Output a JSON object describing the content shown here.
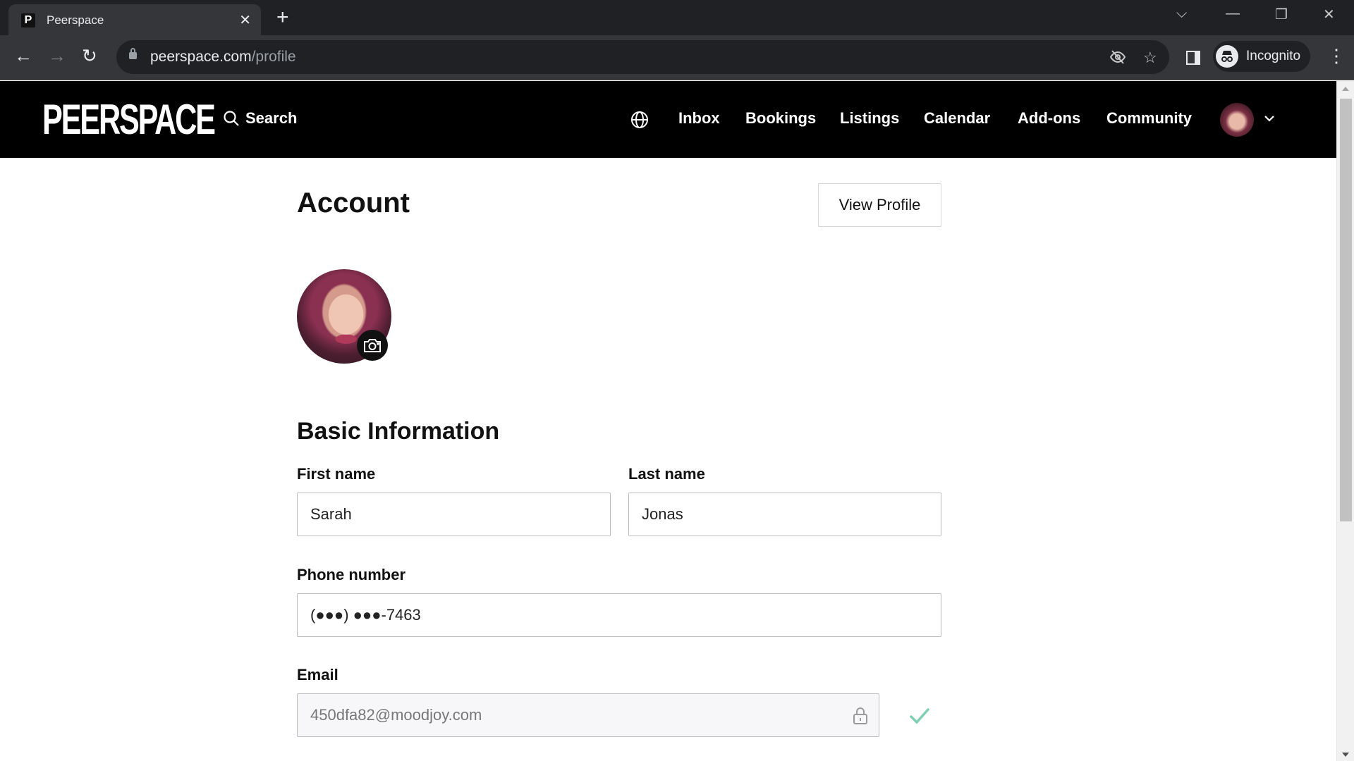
{
  "browser": {
    "tab_title": "Peerspace",
    "tab_favicon": "P",
    "url_host": "peerspace.com",
    "url_path": "/profile",
    "profile_label": "Incognito",
    "icons": [
      "back-arrow-icon",
      "forward-arrow-icon",
      "reload-icon",
      "lock-icon",
      "eye-off-icon",
      "star-icon",
      "side-panel-icon",
      "incognito-icon",
      "kebab-menu-icon"
    ]
  },
  "header": {
    "logo": "PEERSPACE",
    "search_label": "Search",
    "nav": [
      {
        "label": "Inbox"
      },
      {
        "label": "Bookings"
      },
      {
        "label": "Listings"
      },
      {
        "label": "Calendar"
      },
      {
        "label": "Add-ons"
      },
      {
        "label": "Community"
      }
    ]
  },
  "account": {
    "title": "Account",
    "view_profile_label": "View Profile",
    "section_title": "Basic Information",
    "first_name": {
      "label": "First name",
      "value": "Sarah"
    },
    "last_name": {
      "label": "Last name",
      "value": "Jonas"
    },
    "phone": {
      "label": "Phone number",
      "value": "(●●●) ●●●-7463"
    },
    "email": {
      "label": "Email",
      "value": "450dfa82@moodjoy.com",
      "verified": true
    }
  },
  "colors": {
    "header_bg": "#000000",
    "verified_check": "#7ecfb3"
  }
}
